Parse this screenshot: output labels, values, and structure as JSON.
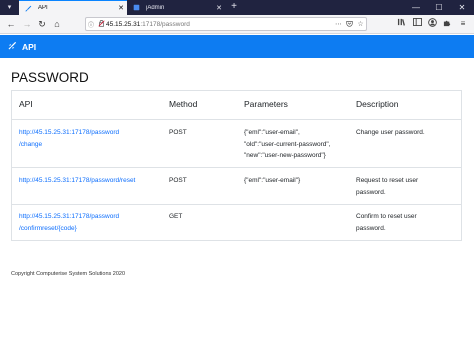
{
  "browser": {
    "tabs": [
      {
        "label": "API",
        "active": true
      },
      {
        "label": "jAdmin",
        "active": false
      }
    ],
    "new_tab_symbol": "+",
    "close_symbol": "✕",
    "url_host": "45.15.25.31",
    "url_path": ":17178/password",
    "window_controls": [
      "—",
      "☐",
      "✕"
    ]
  },
  "app": {
    "brand": "API",
    "brand_color": "#0d7cf2",
    "link_color": "#0d6efd"
  },
  "page": {
    "title": "PASSWORD",
    "table": {
      "headers": [
        "API",
        "Method",
        "Parameters",
        "Description"
      ],
      "rows": [
        {
          "api": "http://45.15.25.31:17178/password\n/change",
          "method": "POST",
          "params": "{\"eml\":\"user-email\",\n\"old\":\"user-current-password\",\n\"new\":\"user-new-password\"}",
          "description": "Change user password."
        },
        {
          "api": "http://45.15.25.31:17178/password/reset",
          "method": "POST",
          "params": "{\"eml\":\"user-email\"}",
          "description": "Request to reset user\npassword."
        },
        {
          "api": "http://45.15.25.31:17178/password\n/confirmreset/{code}",
          "method": "GET",
          "params": "",
          "description": "Confirm to reset user\npassword."
        }
      ]
    },
    "footer": "Copyright Computerise System Solutions 2020"
  }
}
